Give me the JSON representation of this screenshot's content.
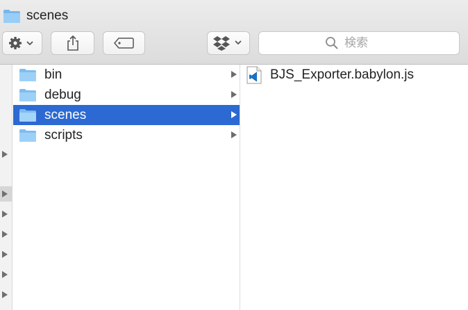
{
  "window": {
    "title": "scenes"
  },
  "toolbar": {
    "action_icon": "gear-icon",
    "share_icon": "share-icon",
    "tags_icon": "tag-icon",
    "dropbox_icon": "dropbox-icon",
    "search_placeholder": "検索"
  },
  "sidebar": {
    "folders": [
      {
        "label": "bin",
        "selected": false
      },
      {
        "label": "debug",
        "selected": false
      },
      {
        "label": "scenes",
        "selected": true
      },
      {
        "label": "scripts",
        "selected": false
      }
    ]
  },
  "contents": {
    "files": [
      {
        "label": "BJS_Exporter.babylon.js",
        "icon": "vscode-file-icon"
      }
    ]
  },
  "colors": {
    "selection": "#2c69d2",
    "folder": "#8cc5f3",
    "vscode": "#1a74c5"
  }
}
